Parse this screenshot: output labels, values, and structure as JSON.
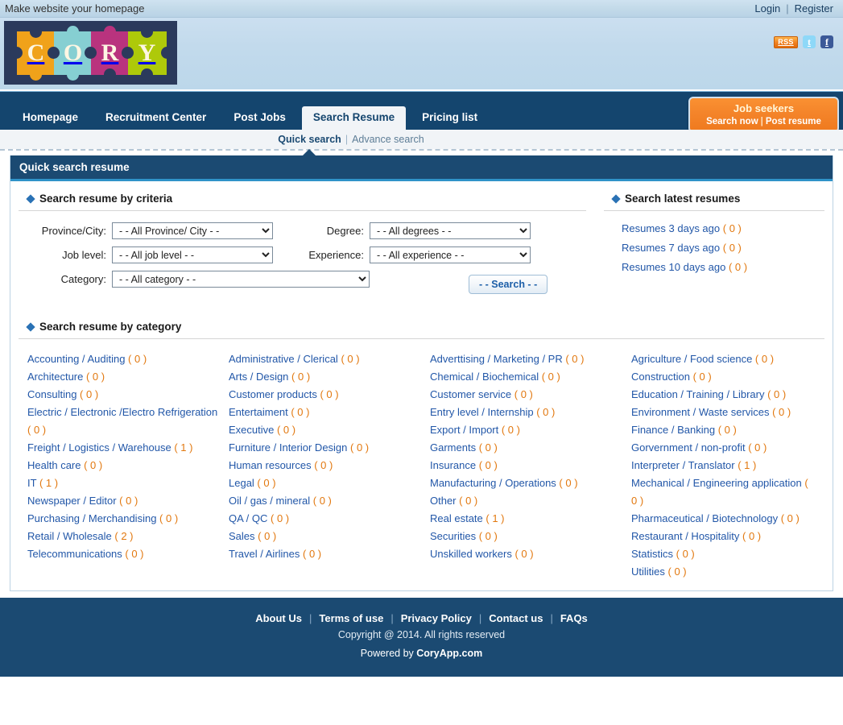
{
  "topbar": {
    "homepage_text": "Make website your homepage",
    "login": "Login",
    "separator": "|",
    "register": "Register"
  },
  "header": {
    "logo_letters": [
      "C",
      "O",
      "R",
      "Y"
    ],
    "logo_colors": [
      "#f0a21a",
      "#86cfd2",
      "#b9337e",
      "#aec90a"
    ],
    "logo_bg": "#2b3a5c",
    "social": {
      "rss": "RSS",
      "twitter": "t",
      "facebook": "f"
    }
  },
  "nav": {
    "items": [
      {
        "label": "Homepage",
        "active": false
      },
      {
        "label": "Recruitment Center",
        "active": false
      },
      {
        "label": "Post Jobs",
        "active": false
      },
      {
        "label": "Search Resume",
        "active": true
      },
      {
        "label": "Pricing list",
        "active": false
      }
    ],
    "jobseekers": {
      "title": "Job seekers",
      "search_now": "Search now",
      "separator": "|",
      "post_resume": "Post resume"
    }
  },
  "subnav": {
    "quick_search": "Quick search",
    "separator": "|",
    "advance_search": "Advance search"
  },
  "panel": {
    "title": "Quick search resume"
  },
  "criteria": {
    "title": "Search resume by criteria",
    "fields": [
      {
        "label": "Province/City:",
        "value": "- - All Province/ City - -"
      },
      {
        "label": "Degree:",
        "value": "- - All degrees - -"
      },
      {
        "label": "Job level:",
        "value": "- - All job level - -"
      },
      {
        "label": "Experience:",
        "value": "- - All experience - -"
      },
      {
        "label": "Category:",
        "value": "- - All category - -"
      }
    ],
    "search_button": "- - Search - -"
  },
  "latest": {
    "title": "Search latest resumes",
    "items": [
      {
        "label": "Resumes 3 days ago",
        "count": "( 0 )"
      },
      {
        "label": "Resumes 7 days ago",
        "count": "( 0 )"
      },
      {
        "label": "Resumes 10 days ago",
        "count": "( 0 )"
      }
    ]
  },
  "categories": {
    "title": "Search resume by category",
    "columns": [
      [
        {
          "label": "Accounting / Auditing",
          "count": "( 0 )"
        },
        {
          "label": "Architecture",
          "count": "( 0 )"
        },
        {
          "label": "Consulting",
          "count": "( 0 )"
        },
        {
          "label": "Electric / Electronic /Electro Refrigeration",
          "count": "( 0 )"
        },
        {
          "label": "Freight / Logistics / Warehouse",
          "count": "( 1 )"
        },
        {
          "label": "Health care",
          "count": "( 0 )"
        },
        {
          "label": "IT",
          "count": "( 1 )"
        },
        {
          "label": "Newspaper / Editor",
          "count": "( 0 )"
        },
        {
          "label": "Purchasing / Merchandising",
          "count": "( 0 )"
        },
        {
          "label": "Retail / Wholesale",
          "count": "( 2 )"
        },
        {
          "label": "Telecommunications",
          "count": "( 0 )"
        }
      ],
      [
        {
          "label": "Administrative / Clerical",
          "count": "( 0 )"
        },
        {
          "label": "Arts / Design",
          "count": "( 0 )"
        },
        {
          "label": "Customer products",
          "count": "( 0 )"
        },
        {
          "label": "Entertaiment",
          "count": "( 0 )"
        },
        {
          "label": "Executive",
          "count": "( 0 )"
        },
        {
          "label": "Furniture / Interior Design",
          "count": "( 0 )"
        },
        {
          "label": "Human resources",
          "count": "( 0 )"
        },
        {
          "label": "Legal",
          "count": "( 0 )"
        },
        {
          "label": "Oil / gas / mineral",
          "count": "( 0 )"
        },
        {
          "label": "QA / QC",
          "count": "( 0 )"
        },
        {
          "label": "Sales",
          "count": "( 0 )"
        },
        {
          "label": "Travel / Airlines",
          "count": "( 0 )"
        }
      ],
      [
        {
          "label": "Adverttising / Marketing / PR",
          "count": "( 0 )"
        },
        {
          "label": "Chemical / Biochemical",
          "count": "( 0 )"
        },
        {
          "label": "Customer service",
          "count": "( 0 )"
        },
        {
          "label": "Entry level / Internship",
          "count": "( 0 )"
        },
        {
          "label": "Export / Import",
          "count": "( 0 )"
        },
        {
          "label": "Garments",
          "count": "( 0 )"
        },
        {
          "label": "Insurance",
          "count": "( 0 )"
        },
        {
          "label": "Manufacturing / Operations",
          "count": "( 0 )"
        },
        {
          "label": "Other",
          "count": "( 0 )"
        },
        {
          "label": "Real estate",
          "count": "( 1 )"
        },
        {
          "label": "Securities",
          "count": "( 0 )"
        },
        {
          "label": "Unskilled workers",
          "count": "( 0 )"
        }
      ],
      [
        {
          "label": "Agriculture / Food science",
          "count": "( 0 )"
        },
        {
          "label": "Construction",
          "count": "( 0 )"
        },
        {
          "label": "Education / Training / Library",
          "count": "( 0 )"
        },
        {
          "label": "Environment / Waste services",
          "count": "( 0 )"
        },
        {
          "label": "Finance / Banking",
          "count": "( 0 )"
        },
        {
          "label": "Gorvernment / non-profit",
          "count": "( 0 )"
        },
        {
          "label": "Interpreter / Translator",
          "count": "( 1 )"
        },
        {
          "label": "Mechanical / Engineering application",
          "count": "( 0 )"
        },
        {
          "label": "Pharmaceutical / Biotechnology",
          "count": "( 0 )"
        },
        {
          "label": "Restaurant / Hospitality",
          "count": "( 0 )"
        },
        {
          "label": "Statistics",
          "count": "( 0 )"
        },
        {
          "label": "Utilities",
          "count": "( 0 )"
        }
      ]
    ]
  },
  "footer": {
    "links": [
      "About Us",
      "Terms of use",
      "Privacy Policy",
      "Contact us",
      "FAQs"
    ],
    "separator": "|",
    "copyright": "Copyright @ 2014. All rights reserved",
    "powered_prefix": "Powered by ",
    "powered_brand": "CoryApp.com"
  },
  "colors": {
    "nav_blue": "#14456e",
    "panel_blue": "#1b4a72",
    "accent_cyan": "#2f93c8",
    "orange": "#f4842a",
    "link_blue": "#2257a8",
    "count_orange": "#e2780f"
  }
}
